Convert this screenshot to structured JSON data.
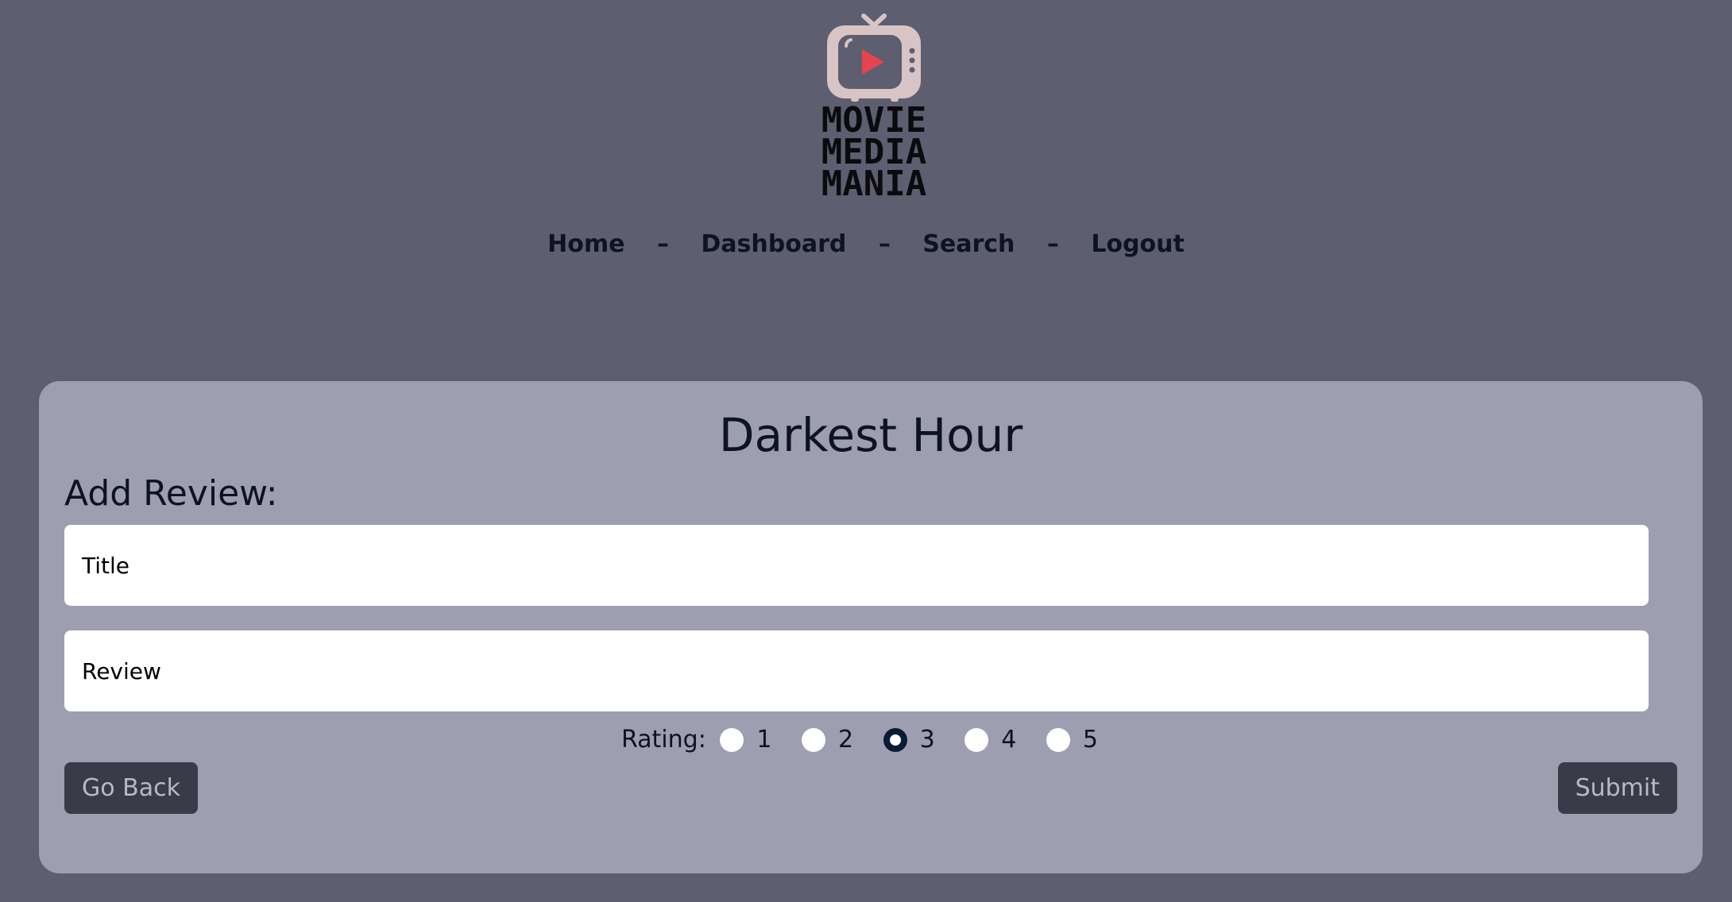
{
  "brand": {
    "logo_lines": [
      "MOVIE",
      "MEDIA",
      "MANIA"
    ],
    "icon": "tv-play-icon",
    "accent_color": "#e5434f"
  },
  "nav": {
    "items": [
      {
        "label": "Home"
      },
      {
        "label": "Dashboard"
      },
      {
        "label": "Search"
      },
      {
        "label": "Logout"
      }
    ],
    "separator": "–"
  },
  "page": {
    "movie_title": "Darkest Hour",
    "section_heading": "Add Review:"
  },
  "form": {
    "title_placeholder": "Title",
    "review_placeholder": "Review",
    "rating_label": "Rating:",
    "rating_options": [
      "1",
      "2",
      "3",
      "4",
      "5"
    ],
    "rating_selected": "3",
    "back_label": "Go Back",
    "submit_label": "Submit"
  },
  "colors": {
    "background": "#5d5e70",
    "card": "#9d9eb0",
    "button": "#3a3b48",
    "text": "#0d1320"
  }
}
